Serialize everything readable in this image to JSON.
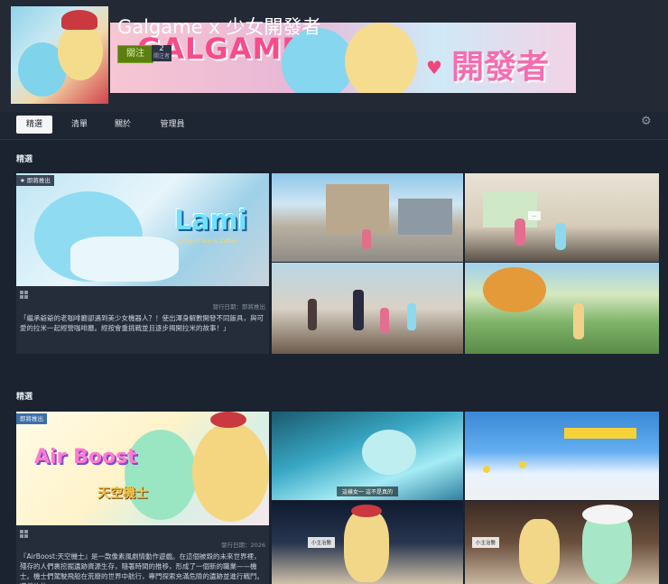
{
  "group": {
    "title": "Galgame x 少女開發者",
    "follow_label": "關注",
    "follower_count": "2",
    "follower_label": "關注者",
    "banner_word": "GALGAME",
    "banner_word2": "開發者"
  },
  "tabs": [
    {
      "label": "精選",
      "active": true
    },
    {
      "label": "清單"
    },
    {
      "label": "關於"
    },
    {
      "label": "管理員"
    }
  ],
  "sections": [
    {
      "label": "精選",
      "badge": "★ 即將推出",
      "game_logo": "Lami",
      "game_logo_sub": "A Cup of Sun & Coffee",
      "release": "發行日期：即將推出",
      "description": "「繼承爺爺的老咖啡廳卻遇到美少女機器人？！使出渾身解數開發不同飯具，與可愛的拉米一起經營咖啡廳。經按會重挑戰並且逐步揭開拉米的故事！」",
      "screenshots": [
        {
          "caption": ""
        },
        {
          "caption": ""
        },
        {
          "caption": ""
        },
        {
          "caption": ""
        }
      ]
    },
    {
      "label": "精選",
      "badge": "即將推出",
      "game_logo": "Air Boost",
      "game_logo_sub": "天空機士",
      "release": "發行日期：2026",
      "description": "『AirBoost:天空機士』是一款像素風劇情動作遊戲。在這個被毀的未來世界裡，殘存的人們裹挖掘遺跡資源生存，隨著時間的推移，形成了一個新的職業——機士。機士們駕駛飛船在荒廢的世界中航行，專門探索充滿危險的遺跡並進行戰鬥。遊戲的故",
      "screenshots": [
        {
          "caption": "這樣女一 這不是真的"
        },
        {
          "caption": ""
        },
        {
          "caption": "小主治醫"
        },
        {
          "caption": "小主治醫"
        }
      ]
    }
  ],
  "colors": {
    "background": "#1b2230",
    "header": "#232a36",
    "follow_green": "#5c7e10",
    "card": "#252d3b",
    "badge_blue": "#3d6fa8"
  }
}
